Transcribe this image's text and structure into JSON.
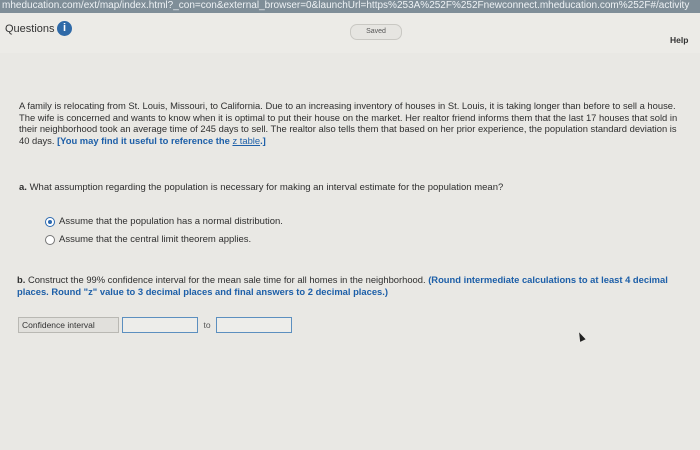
{
  "address_bar": {
    "url_text": "mheducation.com/ext/map/index.html?_con=con&external_browser=0&launchUrl=https%253A%252F%252Fnewconnect.mheducation.com%252F#/activity"
  },
  "header": {
    "questions_label": "Questions",
    "info_icon": "i",
    "saved_status": "Saved",
    "help_label": "Help"
  },
  "problem": {
    "text": "A family is relocating from St. Louis, Missouri, to California. Due to an increasing inventory of houses in St. Louis, it is taking longer than before to sell a house. The wife is concerned and wants to know when it is optimal to put their house on the market. Her realtor friend informs them that the last 17 houses that sold in their neighborhood took an average time of 245 days to sell. The realtor also tells them that based on her prior experience, the population standard deviation is 40 days.",
    "hint_text": "[You may find it useful to reference the",
    "hint_link": "z table",
    "hint_end": ".]"
  },
  "part_a": {
    "prefix": "a.",
    "question": "What assumption regarding the population is necessary for making an interval estimate for the population mean?",
    "options": [
      {
        "label": "Assume that the population has a normal distribution.",
        "selected": true
      },
      {
        "label": "Assume that the central limit theorem applies.",
        "selected": false
      }
    ]
  },
  "part_b": {
    "prefix": "b.",
    "question": "Construct the 99% confidence interval for the mean sale time for all homes in the neighborhood.",
    "instruction": "(Round intermediate calculations to at least 4 decimal places. Round \"z\" value to 3 decimal places and final answers to 2 decimal places.)",
    "ci_label": "Confidence interval",
    "to_label": "to",
    "lower_value": "",
    "upper_value": ""
  },
  "colors": {
    "accent": "#1d5fa8",
    "radio_selected": "#2b69b0",
    "info_icon": "#2f6aa8"
  }
}
